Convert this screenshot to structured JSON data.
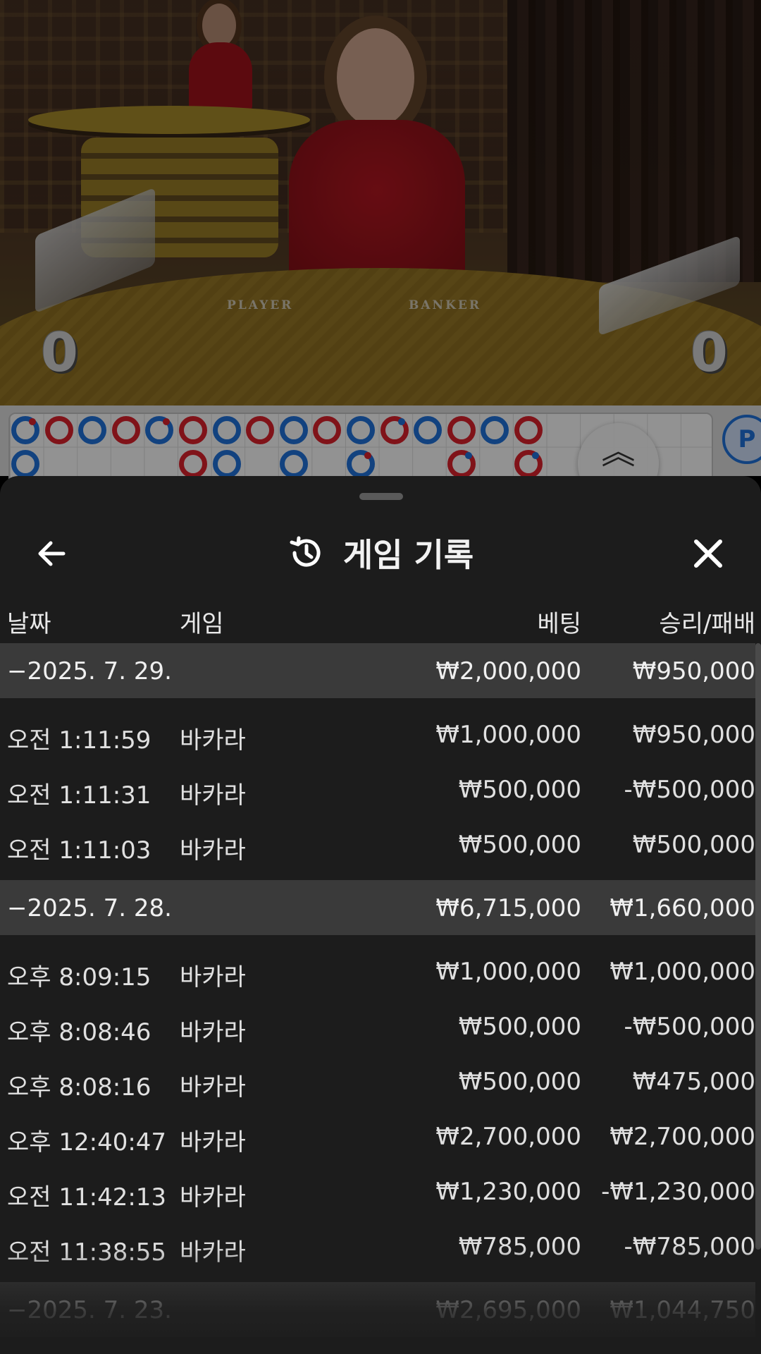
{
  "video": {
    "player_label": "PLAYER",
    "banker_label": "BANKER",
    "player_score": "0",
    "banker_score": "0"
  },
  "bead_road": {
    "top_row": [
      "blue-dot-red",
      "red",
      "blue",
      "red",
      "blue-dot-red",
      "red",
      "blue",
      "red",
      "blue",
      "red",
      "blue",
      "red-dot-blue",
      "blue",
      "red",
      "blue",
      "red"
    ],
    "bottom_row": [
      "blue",
      null,
      null,
      null,
      null,
      "red",
      "blue",
      null,
      "blue",
      null,
      "blue-dot-red",
      null,
      null,
      "red-dot-blue",
      null,
      "red-dot-blue"
    ],
    "toggle_icon": "double-chevron-up-icon",
    "side_badge": "P"
  },
  "sheet": {
    "title": "게임 기록",
    "back_icon": "arrow-left-icon",
    "history_icon": "history-icon",
    "close_icon": "close-icon",
    "columns": {
      "date": "날짜",
      "game": "게임",
      "bet": "베팅",
      "result": "승리/패배"
    },
    "groups": [
      {
        "date": "−2025. 7. 29.",
        "bet_total": "₩2,000,000",
        "result_total": "₩950,000",
        "rows": [
          {
            "time": "오전 1:11:59",
            "game": "바카라",
            "bet": "₩1,000,000",
            "result": "₩950,000"
          },
          {
            "time": "오전 1:11:31",
            "game": "바카라",
            "bet": "₩500,000",
            "result": "-₩500,000"
          },
          {
            "time": "오전 1:11:03",
            "game": "바카라",
            "bet": "₩500,000",
            "result": "₩500,000"
          }
        ]
      },
      {
        "date": "−2025. 7. 28.",
        "bet_total": "₩6,715,000",
        "result_total": "₩1,660,000",
        "rows": [
          {
            "time": "오후 8:09:15",
            "game": "바카라",
            "bet": "₩1,000,000",
            "result": "₩1,000,000"
          },
          {
            "time": "오후 8:08:46",
            "game": "바카라",
            "bet": "₩500,000",
            "result": "-₩500,000"
          },
          {
            "time": "오후 8:08:16",
            "game": "바카라",
            "bet": "₩500,000",
            "result": "₩475,000"
          },
          {
            "time": "오후 12:40:47",
            "game": "바카라",
            "bet": "₩2,700,000",
            "result": "₩2,700,000"
          },
          {
            "time": "오전 11:42:13",
            "game": "바카라",
            "bet": "₩1,230,000",
            "result": "-₩1,230,000"
          },
          {
            "time": "오전 11:38:55",
            "game": "바카라",
            "bet": "₩785,000",
            "result": "-₩785,000"
          }
        ]
      },
      {
        "date": "−2025. 7. 23.",
        "bet_total": "₩2,695,000",
        "result_total": "₩1,044,750",
        "rows": []
      }
    ]
  }
}
